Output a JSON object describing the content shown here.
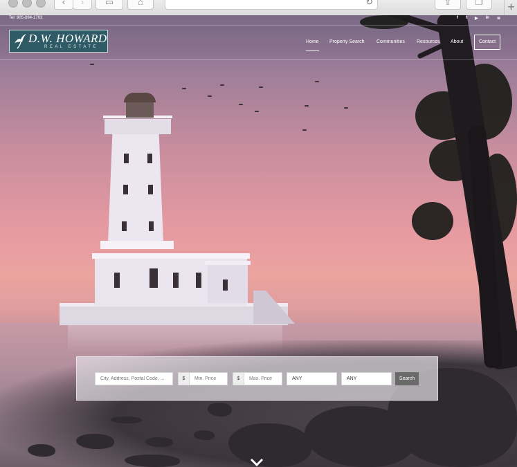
{
  "browser": {
    "back_icon": "chevron-left-icon",
    "forward_icon": "chevron-right-icon",
    "reload_icon": "reload-icon",
    "new_tab_icon": "plus-icon"
  },
  "header": {
    "tel": "Tel: 905-894-1703",
    "social": [
      {
        "icon": "facebook-icon",
        "glyph": "f"
      },
      {
        "icon": "twitter-icon",
        "glyph": "t"
      },
      {
        "icon": "youtube-icon",
        "glyph": "▶"
      },
      {
        "icon": "linkedin-icon",
        "glyph": "in"
      },
      {
        "icon": "rss-icon",
        "glyph": "≋"
      }
    ]
  },
  "logo": {
    "name": "D.W. HOWARD",
    "sub": "REAL ESTATE"
  },
  "nav": {
    "items": [
      {
        "label": "Home",
        "active": true
      },
      {
        "label": "Property Search",
        "active": false
      },
      {
        "label": "Communities",
        "active": false
      },
      {
        "label": "Resources",
        "active": false
      },
      {
        "label": "About",
        "active": false
      }
    ],
    "contact_label": "Contact"
  },
  "search": {
    "location_placeholder": "City, Address, Postal Code, ...",
    "currency_symbol": "$",
    "min_price_placeholder": "Min. Price",
    "max_price_placeholder": "Max. Price",
    "beds_value": "ANY",
    "baths_value": "ANY",
    "button_label": "Search"
  },
  "colors": {
    "logo_bg": "#2e5b66",
    "search_button": "#6a6a6a"
  }
}
